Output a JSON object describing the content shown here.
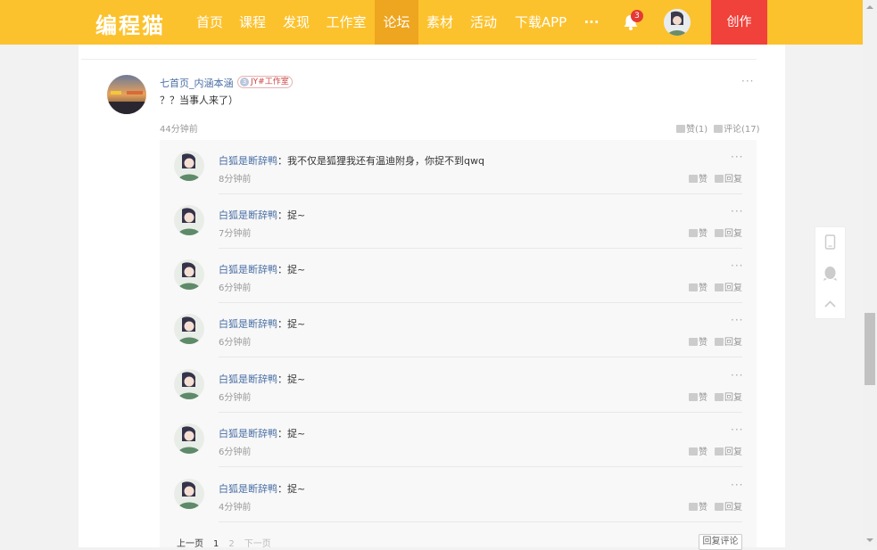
{
  "nav": {
    "logo": "编程猫",
    "items": [
      {
        "label": "首页",
        "active": false
      },
      {
        "label": "课程",
        "active": false
      },
      {
        "label": "发现",
        "active": false
      },
      {
        "label": "工作室",
        "active": false
      },
      {
        "label": "论坛",
        "active": true
      },
      {
        "label": "素材",
        "active": false
      },
      {
        "label": "活动",
        "active": false
      },
      {
        "label": "下载APP",
        "active": false
      }
    ],
    "more": "···",
    "notification_count": "3",
    "create_label": "创作"
  },
  "post": {
    "author": "七首页_内涵本涵",
    "level": "3",
    "studio_tag": "JY#工作室",
    "text": "？？当事人来了）",
    "time": "44分钟前",
    "like_label": "赞(1)",
    "comment_label": "评论(17)",
    "more": "···"
  },
  "replies": [
    {
      "name": "白狐是断辞鸭",
      "text": "：我不仅是狐狸我还有温迪附身，你捉不到qwq",
      "time": "8分钟前",
      "like": "赞",
      "reply": "回复",
      "more": "···"
    },
    {
      "name": "白狐是断辞鸭",
      "text": "：捉~",
      "time": "7分钟前",
      "like": "赞",
      "reply": "回复",
      "more": "···"
    },
    {
      "name": "白狐是断辞鸭",
      "text": "：捉~",
      "time": "6分钟前",
      "like": "赞",
      "reply": "回复",
      "more": "···"
    },
    {
      "name": "白狐是断辞鸭",
      "text": "：捉~",
      "time": "6分钟前",
      "like": "赞",
      "reply": "回复",
      "more": "···"
    },
    {
      "name": "白狐是断辞鸭",
      "text": "：捉~",
      "time": "6分钟前",
      "like": "赞",
      "reply": "回复",
      "more": "···"
    },
    {
      "name": "白狐是断辞鸭",
      "text": "：捉~",
      "time": "6分钟前",
      "like": "赞",
      "reply": "回复",
      "more": "···"
    },
    {
      "name": "白狐是断辞鸭",
      "text": "：捉~",
      "time": "4分钟前",
      "like": "赞",
      "reply": "回复",
      "more": "···"
    }
  ],
  "pager": {
    "prev": "上一页",
    "pages": [
      "1",
      "2"
    ],
    "current": "1",
    "next": "下一页",
    "reply_comment": "回复评论"
  },
  "side_tools": [
    "phone-icon",
    "qq-icon",
    "back-to-top-icon"
  ],
  "colors": {
    "nav_bg": "#fcc22d",
    "nav_active": "#eea51f",
    "create_bg": "#f0413a",
    "link": "#4a6fa5"
  }
}
